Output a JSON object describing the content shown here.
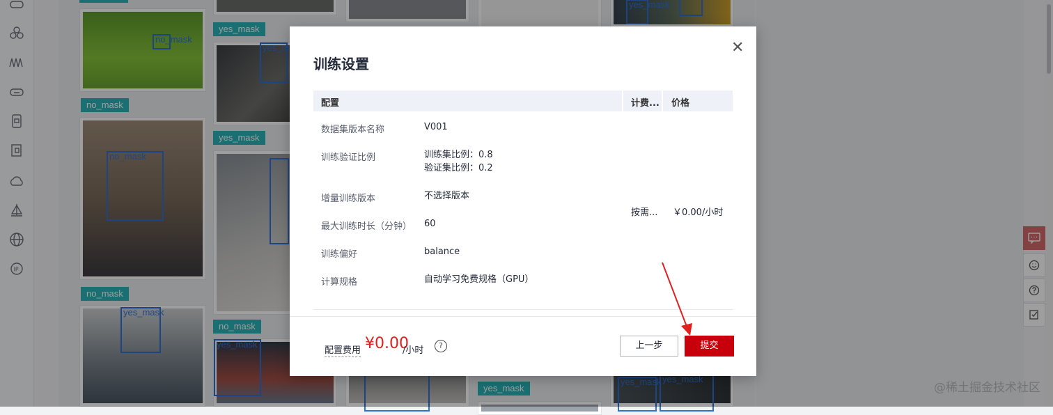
{
  "modal": {
    "title": "训练设置",
    "table_headers": [
      "配置",
      "计费...",
      "价格"
    ],
    "rows": [
      {
        "label": "数据集版本名称",
        "value": "V001"
      },
      {
        "label": "训练验证比例",
        "value_lines": [
          "训练集比例：0.8",
          "验证集比例：0.2"
        ]
      },
      {
        "label": "增量训练版本",
        "value": "不选择版本"
      },
      {
        "label": "最大训练时长（分钟）",
        "value": "60"
      },
      {
        "label": "训练偏好",
        "value": "balance"
      },
      {
        "label": "计算规格",
        "value": "自动学习免费规格（GPU）"
      }
    ],
    "billing_mode": "按需...",
    "price": "￥0.00/小时",
    "footer": {
      "fee_label": "配置费用",
      "fee_amount": "¥0.00",
      "fee_unit": "/小时",
      "prev_button": "上一步",
      "submit_button": "提交"
    }
  },
  "gallery": {
    "tags": [
      "no_mask",
      "yes_mask",
      "no_mask",
      "yes_mask",
      "no_mask",
      "no_mask",
      "yes_mask"
    ],
    "box_labels": [
      "no_mask",
      "yes_mask",
      "no_mask",
      "yes_mask",
      "yes_mask",
      "yes_mask",
      "yes_mask",
      "yes_mask",
      "yes_mask"
    ]
  },
  "watermark": "@稀土掘金技术社区",
  "icons": {
    "left_bar": [
      "cloud-icon",
      "cluster-icon",
      "wave-icon",
      "cloud-storage-icon",
      "device-icon",
      "doc-icon",
      "cloud-up-icon",
      "ship-icon",
      "globe-icon",
      "ip-icon"
    ],
    "floating": [
      "chat-icon",
      "smile-icon",
      "help-icon",
      "edit-icon"
    ]
  },
  "colors": {
    "accent_red": "#c7000b",
    "tag_teal": "#2bb4b8",
    "bbox_blue": "#2f6fd6",
    "annotation_arrow": "#e0201f"
  }
}
